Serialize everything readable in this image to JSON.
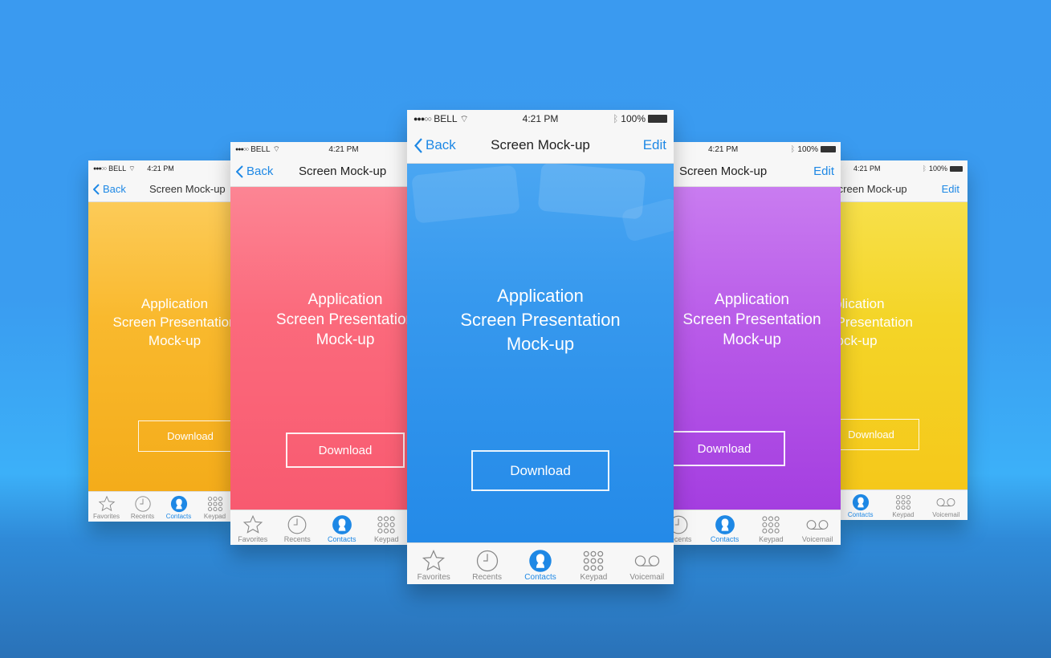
{
  "status": {
    "carrier": "BELL",
    "time": "4:21 PM",
    "battery": "100%"
  },
  "nav": {
    "back_label": "Back",
    "title": "Screen Mock-up",
    "edit_label": "Edit"
  },
  "content": {
    "line1": "Application",
    "line2": "Screen Presentation",
    "line3": "Mock-up",
    "download_label": "Download"
  },
  "tabs": [
    {
      "label": "Favorites",
      "icon": "star-icon"
    },
    {
      "label": "Recents",
      "icon": "clock-icon"
    },
    {
      "label": "Contacts",
      "icon": "contact-icon",
      "active": true
    },
    {
      "label": "Keypad",
      "icon": "keypad-icon"
    },
    {
      "label": "Voicemail",
      "icon": "voicemail-icon"
    }
  ],
  "colors": {
    "accent": "#1e88e5",
    "background": "#3a9af0",
    "screens": {
      "yellow_orange": "#f9b423",
      "pink": "#fb6478",
      "blue": "#2a90ea",
      "purple": "#b54ce6",
      "yellow": "#f8d21a"
    }
  }
}
